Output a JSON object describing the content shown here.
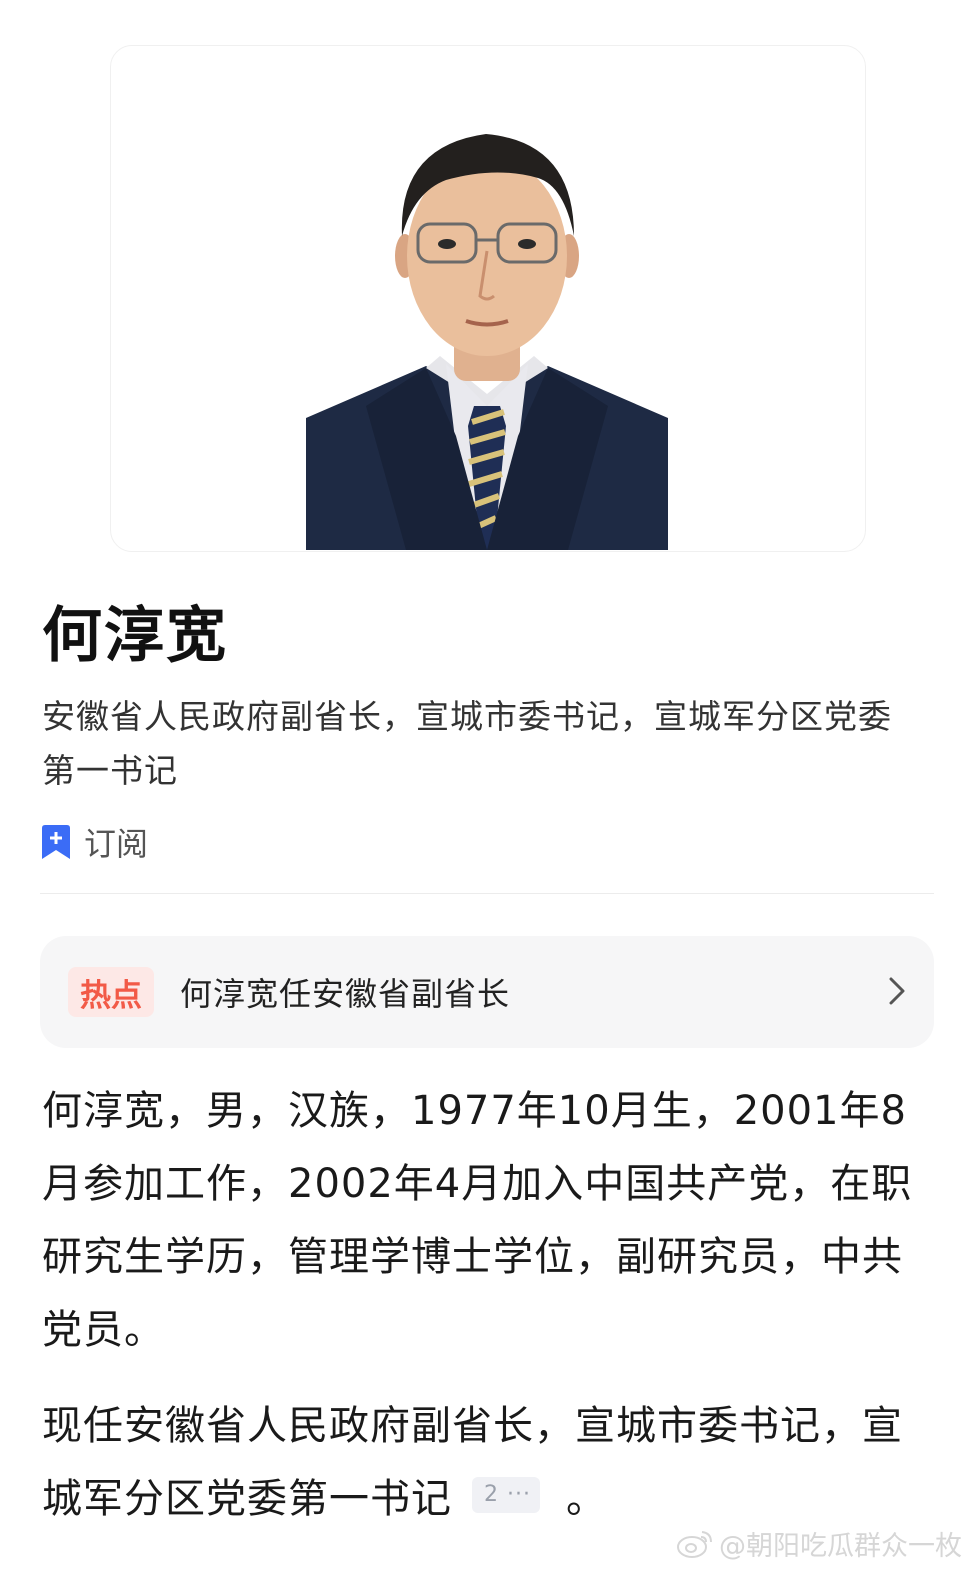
{
  "profile": {
    "name": "何淳宽",
    "subtitle": "安徽省人民政府副省长，宣城市委书记，宣城军分区党委第一书记"
  },
  "subscribe": {
    "label": "订阅",
    "icon": "bookmark-plus-icon"
  },
  "hot": {
    "badge": "热点",
    "text": "何淳宽任安徽省副省长",
    "icon": "chevron-right-icon"
  },
  "bio": {
    "paragraph1": "何淳宽，男，汉族，1977年10月生，2001年8月参加工作，2002年4月加入中国共产党，在职研究生学历，管理学博士学位，副研究员，中共党员。",
    "paragraph2": "现任安徽省人民政府副省长，宣城市委书记，宣城军分区党委第一书记",
    "citation": "2 ···",
    "paragraph2_end": "。"
  },
  "watermark": {
    "text": "@朝阳吃瓜群众一枚",
    "icon": "weibo-icon"
  },
  "colors": {
    "accent": "#3b6cf6",
    "hot": "#f25a47",
    "hot_bg": "#fde8e6",
    "card_bg": "#f6f6f7"
  }
}
